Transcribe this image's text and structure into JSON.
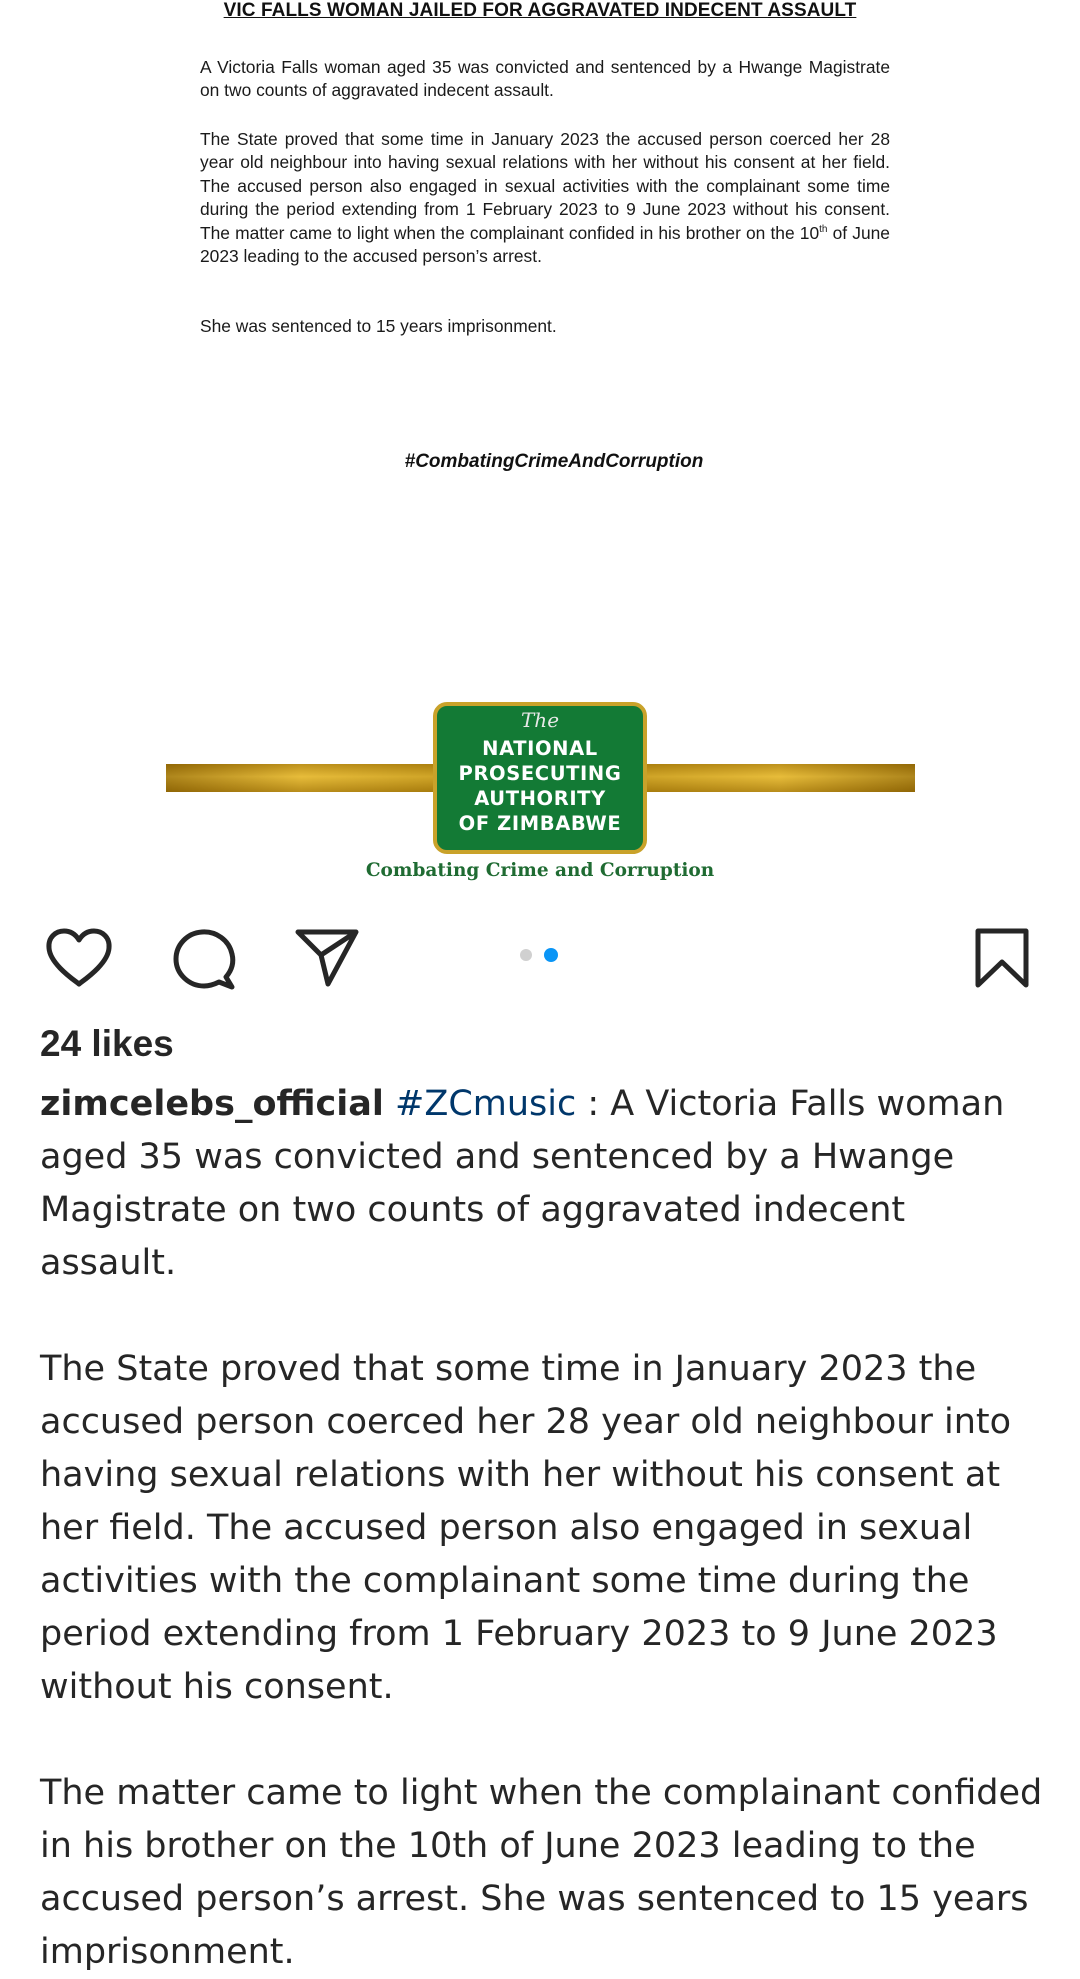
{
  "post_image": {
    "document_title": "VIC FALLS WOMAN JAILED FOR AGGRAVATED INDECENT ASSAULT",
    "paragraphs": [
      "A Victoria Falls woman aged 35 was convicted and sentenced by a Hwange Magistrate on two counts of aggravated indecent assault.",
      "The State proved that some time in January 2023 the accused person coerced her 28 year old neighbour into having sexual relations with her without his consent at her field. The accused person also engaged in sexual activities with the complainant some time during the period extending from 1 February 2023 to 9 June 2023 without his consent. The matter came to light when the complainant confided in his brother on the 10th of June 2023 leading to the accused person’s arrest.",
      "She was sentenced to 15 years imprisonment."
    ],
    "hashtag": "#CombatingCrimeAndCorruption",
    "logo": {
      "the": "The",
      "lines": [
        "NATIONAL",
        "PROSECUTING",
        "AUTHORITY",
        "OF ZIMBABWE"
      ],
      "tagline": "Combating Crime and Corruption",
      "colors": {
        "green": "#137a35",
        "gold": "#c9a22a"
      }
    }
  },
  "actions": {
    "icons": [
      "like-icon",
      "comment-icon",
      "share-icon",
      "save-icon"
    ],
    "carousel": {
      "total": 2,
      "current": 2,
      "active_color": "#0a95f6"
    }
  },
  "likes": "24 likes",
  "caption": {
    "username": "zimcelebs_official",
    "hashtag": "#ZCmusic",
    "intro": " : A Victoria Falls woman aged 35 was convicted and sentenced by a Hwange Magistrate on two counts of aggravated indecent assault.",
    "para2": "The State proved that some time in January 2023 the accused person coerced her 28 year old neighbour into having sexual relations with her without his consent at her field. The accused person also engaged in sexual activities with the complainant some time during the period extending from 1 February 2023 to 9 June 2023 without his consent.",
    "para3": "The matter came to light when the complainant confided in his brother on the 10th of June 2023 leading to the accused person’s arrest. She was sentenced to 15 years imprisonment."
  }
}
